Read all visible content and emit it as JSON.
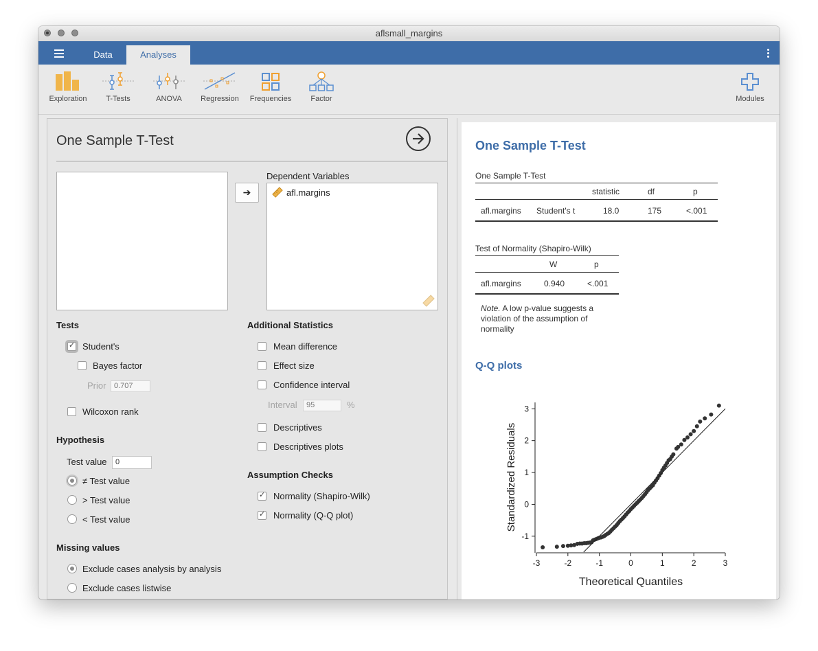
{
  "window": {
    "title": "aflsmall_margins"
  },
  "nav": {
    "tabs": [
      {
        "label": "Data"
      },
      {
        "label": "Analyses"
      }
    ]
  },
  "ribbon": [
    {
      "label": "Exploration",
      "icon": "exploration-icon"
    },
    {
      "label": "T-Tests",
      "icon": "t-tests-icon"
    },
    {
      "label": "ANOVA",
      "icon": "anova-icon"
    },
    {
      "label": "Regression",
      "icon": "regression-icon"
    },
    {
      "label": "Frequencies",
      "icon": "frequencies-icon"
    },
    {
      "label": "Factor",
      "icon": "factor-icon"
    },
    {
      "label": "Modules",
      "icon": "modules-plus-icon"
    }
  ],
  "colors": {
    "accent": "#3e6da8",
    "ribbon_orange": "#f0b54a"
  },
  "options": {
    "title": "One Sample T-Test",
    "move_arrow": "➔",
    "dependent_label": "Dependent Variables",
    "dependent_vars": [
      "afl.margins"
    ],
    "tests": {
      "heading": "Tests",
      "students": {
        "label": "Student's",
        "checked": true
      },
      "bayes": {
        "label": "Bayes factor",
        "checked": false
      },
      "prior": {
        "label": "Prior",
        "value": "0.707"
      },
      "wilcoxon": {
        "label": "Wilcoxon rank",
        "checked": false
      }
    },
    "additional": {
      "heading": "Additional Statistics",
      "mean_diff": {
        "label": "Mean difference",
        "checked": false
      },
      "effect_size": {
        "label": "Effect size",
        "checked": false
      },
      "ci": {
        "label": "Confidence interval",
        "checked": false
      },
      "interval": {
        "label": "Interval",
        "value": "95",
        "unit": "%"
      },
      "descriptives": {
        "label": "Descriptives",
        "checked": false
      },
      "desc_plots": {
        "label": "Descriptives plots",
        "checked": false
      }
    },
    "hypothesis": {
      "heading": "Hypothesis",
      "test_value_label": "Test value",
      "test_value": "0",
      "neq": "≠ Test value",
      "gt": "> Test value",
      "lt": "< Test value",
      "selected": "neq"
    },
    "assumptions": {
      "heading": "Assumption Checks",
      "shapiro": {
        "label": "Normality (Shapiro-Wilk)",
        "checked": true
      },
      "qq": {
        "label": "Normality (Q-Q plot)",
        "checked": true
      }
    },
    "missing": {
      "heading": "Missing values",
      "analysis": "Exclude cases analysis by analysis",
      "listwise": "Exclude cases listwise",
      "selected": "analysis"
    }
  },
  "results": {
    "heading": "One Sample T-Test",
    "ttest_table": {
      "caption": "One Sample T-Test",
      "headers": [
        "statistic",
        "df",
        "p"
      ],
      "row": {
        "var": "afl.margins",
        "test": "Student's t",
        "statistic": "18.0",
        "df": "175",
        "p": "<.001"
      }
    },
    "normality_table": {
      "caption": "Test of Normality (Shapiro-Wilk)",
      "headers": [
        "W",
        "p"
      ],
      "row": {
        "var": "afl.margins",
        "W": "0.940",
        "p": "<.001"
      },
      "note_label": "Note.",
      "note_text": " A low p-value suggests a violation of the assumption of normality"
    },
    "qq_heading": "Q-Q plots"
  },
  "chart_data": {
    "type": "scatter",
    "title": "",
    "xlabel": "Theoretical Quantiles",
    "ylabel": "Standardized Residuals",
    "xlim": [
      -3,
      3
    ],
    "ylim": [
      -1.5,
      3.2
    ],
    "xticks": [
      -3,
      -2,
      -1,
      0,
      1,
      2,
      3
    ],
    "yticks": [
      -1,
      0,
      1,
      2,
      3
    ],
    "reference_line": {
      "slope": 1,
      "intercept": 0
    },
    "points": [
      [
        -2.8,
        -1.35
      ],
      [
        -2.35,
        -1.33
      ],
      [
        -2.15,
        -1.31
      ],
      [
        -2.0,
        -1.3
      ],
      [
        -1.9,
        -1.29
      ],
      [
        -1.8,
        -1.28
      ],
      [
        -1.7,
        -1.24
      ],
      [
        -1.62,
        -1.23
      ],
      [
        -1.55,
        -1.23
      ],
      [
        -1.48,
        -1.22
      ],
      [
        -1.42,
        -1.22
      ],
      [
        -1.36,
        -1.21
      ],
      [
        -1.3,
        -1.2
      ],
      [
        -1.25,
        -1.19
      ],
      [
        -1.2,
        -1.13
      ],
      [
        -1.15,
        -1.11
      ],
      [
        -1.1,
        -1.09
      ],
      [
        -1.05,
        -1.07
      ],
      [
        -1.0,
        -1.05
      ],
      [
        -0.95,
        -1.04
      ],
      [
        -0.9,
        -1.02
      ],
      [
        -0.85,
        -1.0
      ],
      [
        -0.8,
        -0.96
      ],
      [
        -0.75,
        -0.93
      ],
      [
        -0.7,
        -0.9
      ],
      [
        -0.65,
        -0.85
      ],
      [
        -0.6,
        -0.8
      ],
      [
        -0.55,
        -0.75
      ],
      [
        -0.5,
        -0.7
      ],
      [
        -0.45,
        -0.65
      ],
      [
        -0.4,
        -0.59
      ],
      [
        -0.35,
        -0.53
      ],
      [
        -0.3,
        -0.48
      ],
      [
        -0.25,
        -0.43
      ],
      [
        -0.2,
        -0.38
      ],
      [
        -0.15,
        -0.32
      ],
      [
        -0.1,
        -0.26
      ],
      [
        -0.05,
        -0.21
      ],
      [
        0.0,
        -0.15
      ],
      [
        0.05,
        -0.1
      ],
      [
        0.1,
        -0.05
      ],
      [
        0.15,
        0.0
      ],
      [
        0.2,
        0.05
      ],
      [
        0.25,
        0.1
      ],
      [
        0.3,
        0.15
      ],
      [
        0.35,
        0.2
      ],
      [
        0.4,
        0.26
      ],
      [
        0.45,
        0.32
      ],
      [
        0.5,
        0.38
      ],
      [
        0.55,
        0.45
      ],
      [
        0.6,
        0.5
      ],
      [
        0.65,
        0.55
      ],
      [
        0.7,
        0.6
      ],
      [
        0.75,
        0.68
      ],
      [
        0.8,
        0.75
      ],
      [
        0.85,
        0.82
      ],
      [
        0.9,
        0.9
      ],
      [
        0.95,
        0.98
      ],
      [
        1.0,
        1.07
      ],
      [
        1.05,
        1.15
      ],
      [
        1.1,
        1.22
      ],
      [
        1.15,
        1.3
      ],
      [
        1.2,
        1.38
      ],
      [
        1.25,
        1.42
      ],
      [
        1.3,
        1.5
      ],
      [
        1.35,
        1.57
      ],
      [
        1.45,
        1.75
      ],
      [
        1.5,
        1.8
      ],
      [
        1.6,
        1.88
      ],
      [
        1.7,
        2.02
      ],
      [
        1.8,
        2.1
      ],
      [
        1.9,
        2.2
      ],
      [
        2.0,
        2.3
      ],
      [
        2.1,
        2.45
      ],
      [
        2.2,
        2.6
      ],
      [
        2.35,
        2.7
      ],
      [
        2.55,
        2.82
      ],
      [
        2.8,
        3.1
      ]
    ]
  }
}
